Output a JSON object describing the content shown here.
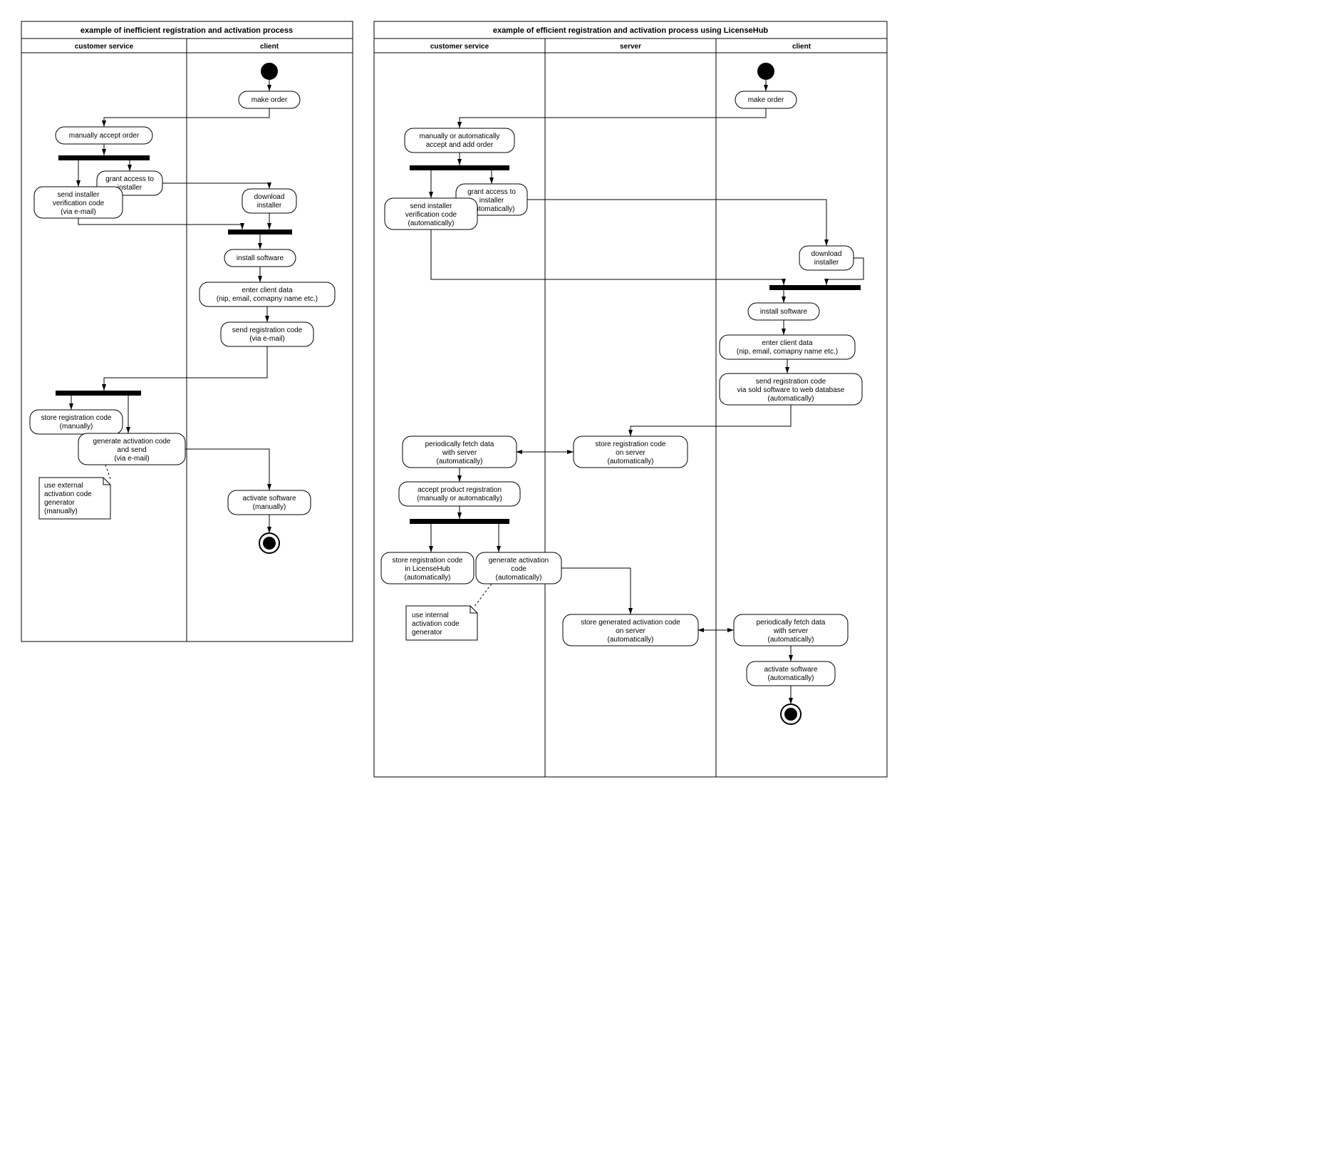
{
  "left": {
    "title": "example of inefficient registration and activation process",
    "lanes": [
      "customer service",
      "client"
    ],
    "activities": {
      "make_order": "make order",
      "accept_order": "manually accept order",
      "grant_access": "grant access to\ninstaller",
      "send_code_email": "send installer\nverification code\n(via e-mail)",
      "download": "download\ninstaller",
      "install": "install software",
      "enter_data": "enter client data\n(nip, email, comapny name etc.)",
      "send_reg": "send registration code\n(via e-mail)",
      "store_reg": "store registration code\n(manually)",
      "gen_send": "generate activation code\nand send\n(via e-mail)",
      "note": "use external\nactivation code\ngenerator\n(manually)",
      "activate": "activate software\n(manually)"
    }
  },
  "right": {
    "title": "example of efficient registration and activation process using LicenseHub",
    "lanes": [
      "customer service",
      "server",
      "client"
    ],
    "activities": {
      "make_order": "make order",
      "accept_order": "manually or automatically\naccept and add order",
      "grant_access": "grant access to\ninstaller\n(automatically)",
      "send_code": "send installer\nverification code\n(automatically)",
      "download": "download\ninstaller",
      "install": "install software",
      "enter_data": "enter client data\n(nip, email, comapny name etc.)",
      "send_reg": "send registration code\nvia sold software to web database\n(automatically)",
      "store_reg_server": "store registration code\non server\n(automatically)",
      "fetch1": "periodically fetch data\nwith server\n(automatically)",
      "accept_reg": "accept product registration\n(manually or automatically)",
      "store_reg_lh": "store registration code\nin LicenseHub\n(automatically)",
      "gen_code": "generate activation\ncode\n(automatically)",
      "note": "use internal\nactivation code\ngenerator",
      "store_act_server": "store generated activation code\non server\n(automatically)",
      "fetch2": "periodically fetch data\nwith server\n(automatically)",
      "activate": "activate software\n(automatically)"
    }
  }
}
